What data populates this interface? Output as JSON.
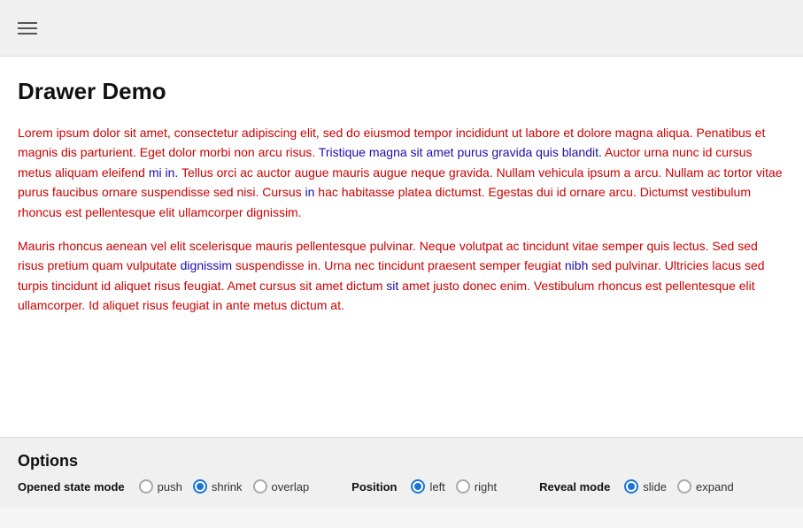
{
  "header": {
    "hamburger_label": "Menu"
  },
  "main": {
    "title": "Drawer Demo",
    "paragraph1": "Lorem ipsum dolor sit amet, consectetur adipiscing elit, sed do eiusmod tempor incididunt ut labore et dolore magna aliqua. Penatibus et magnis dis parturient. Eget dolor morbi non arcu risus. Tristique magna sit amet purus gravida quis blandit. Auctor urna nunc id cursus metus aliquam eleifend mi in. Tellus orci ac auctor augue mauris augue neque gravida. Nullam vehicula ipsum a arcu. Nullam ac tortor vitae purus faucibus ornare suspendisse sed nisi. Cursus in hac habitasse platea dictumst. Egestas dui id ornare arcu. Dictumst vestibulum rhoncus est pellentesque elit ullamcorper dignissim.",
    "paragraph2": "Mauris rhoncus aenean vel elit scelerisque mauris pellentesque pulvinar. Neque volutpat ac tincidunt vitae semper quis lectus. Sed sed risus pretium quam vulputate dignissim suspendisse in. Urna nec tincidunt praesent semper feugiat nibh sed pulvinar. Ultricies lacus sed turpis tincidunt id aliquet risus feugiat. Amet cursus sit amet dictum sit amet justo donec enim. Vestibulum rhoncus est pellentesque elit ullamcorper. Id aliquet risus feugiat in ante metus dictum at."
  },
  "options": {
    "title": "Options",
    "opened_state_mode": {
      "label": "Opened state mode",
      "items": [
        "push",
        "shrink",
        "overlap"
      ],
      "selected": "shrink"
    },
    "position": {
      "label": "Position",
      "items": [
        "left",
        "right"
      ],
      "selected": "left"
    },
    "reveal_mode": {
      "label": "Reveal mode",
      "items": [
        "slide",
        "expand"
      ],
      "selected": "slide"
    }
  }
}
